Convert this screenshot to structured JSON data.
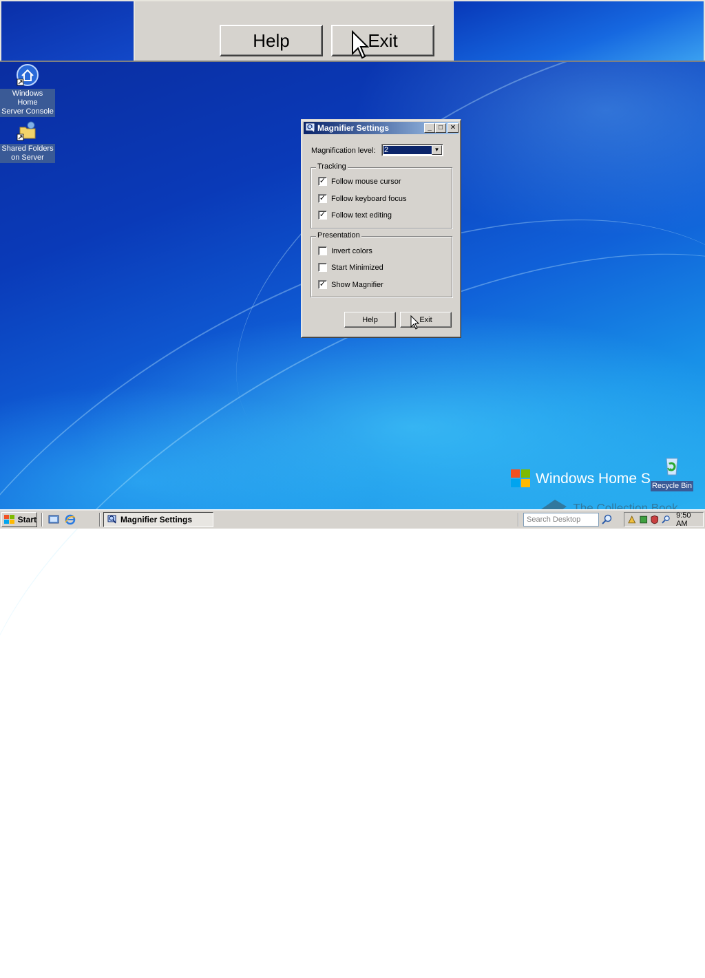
{
  "magnifier_view": {
    "help_label": "Help",
    "exit_label": "Exit"
  },
  "desktop_icons": [
    {
      "label_line1": "Windows Home",
      "label_line2": "Server Console"
    },
    {
      "label_line1": "Shared Folders",
      "label_line2": "on Server"
    },
    {
      "label_line1": "Recycle Bin"
    }
  ],
  "dialog": {
    "title": "Magnifier Settings",
    "minimize": "_",
    "maximize": "□",
    "close": "✕",
    "magnification_label": "Magnification level:",
    "magnification_value": "2",
    "tracking_title": "Tracking",
    "tracking": [
      {
        "label": "Follow mouse cursor",
        "checked": true
      },
      {
        "label": "Follow keyboard focus",
        "checked": true
      },
      {
        "label": "Follow text editing",
        "checked": true
      }
    ],
    "presentation_title": "Presentation",
    "presentation": [
      {
        "label": "Invert colors",
        "checked": false
      },
      {
        "label": "Start Minimized",
        "checked": false
      },
      {
        "label": "Show Magnifier",
        "checked": true
      }
    ],
    "help_label": "Help",
    "exit_label": "Exit"
  },
  "branding": {
    "text": "Windows Home S"
  },
  "taskbar": {
    "start_label": "Start",
    "task_item_label": "Magnifier Settings",
    "search_placeholder": "Search Desktop",
    "clock": "9:50 AM"
  },
  "watermark": "The Collection Book",
  "check_mark": "✓"
}
